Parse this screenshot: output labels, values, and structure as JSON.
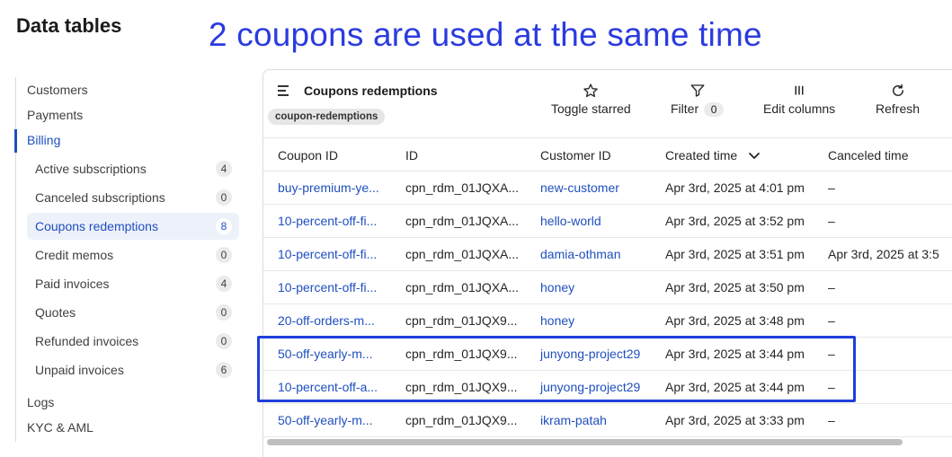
{
  "page_title": "Data tables",
  "annotation": "2 coupons are used at the same time",
  "sidebar": {
    "top_items": [
      "Customers",
      "Payments"
    ],
    "active_section": "Billing",
    "sub_items": [
      {
        "label": "Active subscriptions",
        "count": "4"
      },
      {
        "label": "Canceled subscriptions",
        "count": "0"
      },
      {
        "label": "Coupons redemptions",
        "count": "8"
      },
      {
        "label": "Credit memos",
        "count": "0"
      },
      {
        "label": "Paid invoices",
        "count": "4"
      },
      {
        "label": "Quotes",
        "count": "0"
      },
      {
        "label": "Refunded invoices",
        "count": "0"
      },
      {
        "label": "Unpaid invoices",
        "count": "6"
      }
    ],
    "bottom_items": [
      "Logs",
      "KYC & AML"
    ]
  },
  "table": {
    "title": "Coupons redemptions",
    "tag": "coupon-redemptions",
    "toolbar": {
      "toggle_starred": "Toggle starred",
      "filter": "Filter",
      "filter_count": "0",
      "edit_columns": "Edit columns",
      "refresh": "Refresh"
    },
    "columns": [
      "Coupon ID",
      "ID",
      "Customer ID",
      "Created time",
      "Canceled time"
    ],
    "rows": [
      {
        "coupon": "buy-premium-ye...",
        "id": "cpn_rdm_01JQXA...",
        "customer": "new-customer",
        "created": "Apr 3rd, 2025 at 4:01 pm",
        "canceled": "–"
      },
      {
        "coupon": "10-percent-off-fi...",
        "id": "cpn_rdm_01JQXA...",
        "customer": "hello-world",
        "created": "Apr 3rd, 2025 at 3:52 pm",
        "canceled": "–"
      },
      {
        "coupon": "10-percent-off-fi...",
        "id": "cpn_rdm_01JQXA...",
        "customer": "damia-othman",
        "created": "Apr 3rd, 2025 at 3:51 pm",
        "canceled": "Apr 3rd, 2025 at 3:5"
      },
      {
        "coupon": "10-percent-off-fi...",
        "id": "cpn_rdm_01JQXA...",
        "customer": "honey",
        "created": "Apr 3rd, 2025 at 3:50 pm",
        "canceled": "–"
      },
      {
        "coupon": "20-off-orders-m...",
        "id": "cpn_rdm_01JQX9...",
        "customer": "honey",
        "created": "Apr 3rd, 2025 at 3:48 pm",
        "canceled": "–"
      },
      {
        "coupon": "50-off-yearly-m...",
        "id": "cpn_rdm_01JQX9...",
        "customer": "junyong-project29",
        "created": "Apr 3rd, 2025 at 3:44 pm",
        "canceled": "–"
      },
      {
        "coupon": "10-percent-off-a...",
        "id": "cpn_rdm_01JQX9...",
        "customer": "junyong-project29",
        "created": "Apr 3rd, 2025 at 3:44 pm",
        "canceled": "–"
      },
      {
        "coupon": "50-off-yearly-m...",
        "id": "cpn_rdm_01JQX9...",
        "customer": "ikram-patah",
        "created": "Apr 3rd, 2025 at 3:33 pm",
        "canceled": "–"
      }
    ]
  },
  "colors": {
    "accent": "#1f4fbf",
    "annotation": "#2b3bdf",
    "highlight_box": "#1f3fd9"
  }
}
